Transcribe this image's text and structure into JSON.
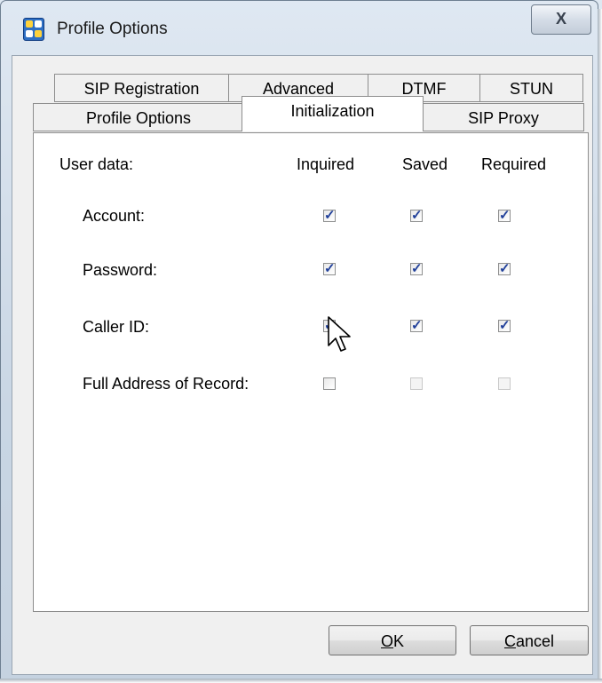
{
  "window": {
    "title": "Profile Options",
    "close_label": "X",
    "icon": "app-grid-icon"
  },
  "tabs": {
    "row_back": [
      "SIP Registration",
      "Advanced",
      "DTMF",
      "STUN"
    ],
    "row_front": [
      "Profile Options",
      "Initialization",
      "SIP Proxy"
    ],
    "active": "Initialization"
  },
  "grid": {
    "label_header": "User data:",
    "columns": [
      "Inquired",
      "Saved",
      "Required"
    ],
    "rows": [
      {
        "label": "Account:",
        "inquired": true,
        "saved": true,
        "required": true,
        "saved_enabled": true,
        "required_enabled": true
      },
      {
        "label": "Password:",
        "inquired": true,
        "saved": true,
        "required": true,
        "saved_enabled": true,
        "required_enabled": true
      },
      {
        "label": "Caller ID:",
        "inquired": true,
        "saved": true,
        "required": true,
        "saved_enabled": true,
        "required_enabled": true
      },
      {
        "label": "Full Address of Record:",
        "inquired": false,
        "saved": false,
        "required": false,
        "saved_enabled": false,
        "required_enabled": false
      }
    ]
  },
  "buttons": {
    "ok_label": "OK",
    "ok_mnemonic": "O",
    "cancel_label": "Cancel",
    "cancel_mnemonic": "C"
  }
}
